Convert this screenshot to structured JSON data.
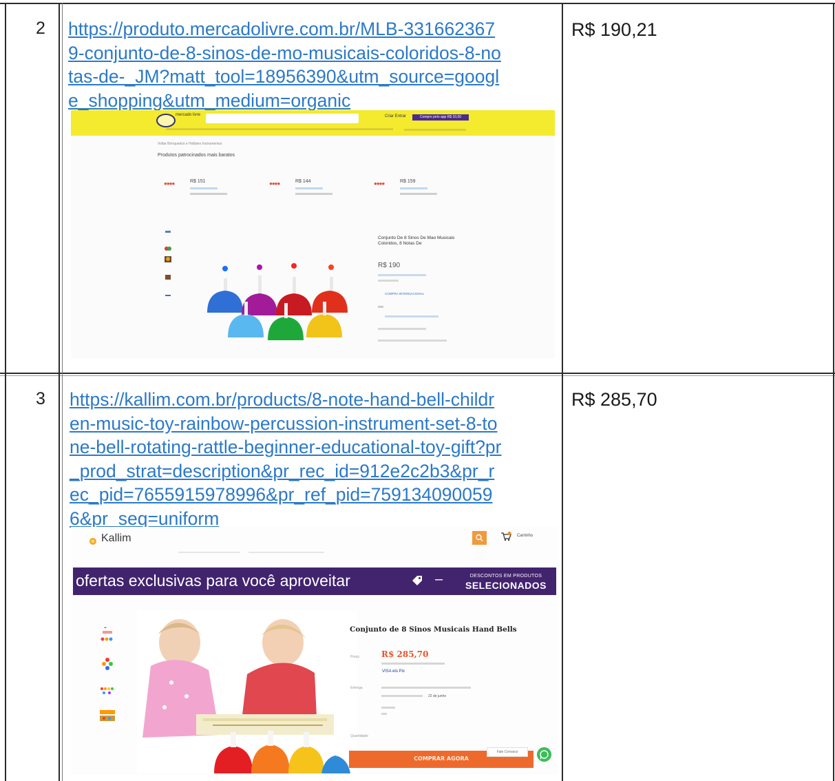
{
  "rows": [
    {
      "number": "2",
      "url": "https://produto.mercadolivre.com.br/MLB-3316623679-conjunto-de-8-sinos-de-mo-musicais-coloridos-8-notas-de-_JM?matt_tool=18956390&utm_source=google_shopping&utm_medium=organic",
      "url_lines": [
        "https://produto.mercadolivre.com.br/MLB-331662367",
        "9-conjunto-de-8-sinos-de-mo-musicais-coloridos-8-no",
        "tas-de-_JM?matt_tool=18956390&utm_source=googl",
        "e_shopping&utm_medium=organic"
      ],
      "price": "R$ 190,21",
      "screenshot": {
        "site": "Mercado Livre",
        "logo_text": "mercado livre",
        "user_text": "Criar  Entrar",
        "promo_text": "Compre pelo app R$ 10,00",
        "breadcrumb": "Voltar  Brinquedos e Hobbies  Instrumentos",
        "section_heading": "Produtos patrocinados mais baratos",
        "cards": [
          {
            "price": "R$ 151"
          },
          {
            "price": "R$ 144"
          },
          {
            "price": "R$ 159"
          }
        ],
        "product_title": "Conjunto De 8 Sinos De Mao Musicais Coloridos, 8 Notas De",
        "product_price": "R$ 190",
        "shipping_label": "COMPRA INTERNACIONAL"
      }
    },
    {
      "number": "3",
      "url": "https://kallim.com.br/products/8-note-hand-bell-children-music-toy-rainbow-percussion-instrument-set-8-tone-bell-rotating-rattle-beginner-educational-toy-gift?pr_prod_strat=description&pr_rec_id=912e2c2b3&pr_rec_pid=7655915978996&pr_ref_pid=7591340900596&pr_seq=uniform",
      "url_lines": [
        "https://kallim.com.br/products/8-note-hand-bell-childr",
        "en-music-toy-rainbow-percussion-instrument-set-8-to",
        "ne-bell-rotating-rattle-beginner-educational-toy-gift?pr",
        "_prod_strat=description&pr_rec_id=912e2c2b3&pr_r",
        "ec_pid=7655915978996&pr_ref_pid=759134090059",
        "6&pr_seq=uniform"
      ],
      "price": "R$ 285,70",
      "screenshot": {
        "site": "Kallim",
        "logo_text": "Kallim",
        "cart_label": "Carrinho",
        "banner_text": "ofertas exclusivas para você aproveitar",
        "banner_small": "DESCONTOS EM PRODUTOS",
        "banner_big": "SELECIONADOS",
        "product_title": "Conjunto de 8 Sinos Musicais Hand Bells",
        "price_label": "Preço",
        "product_price": "R$ 285,70",
        "payment_text": "VISA  elo  Pix",
        "delivery_label": "Entrega",
        "delivery_text": "22 de junho",
        "quantity_label": "Quantidade",
        "buy_button": "COMPRAR AGORA",
        "chat_label": "Fale Conosco"
      }
    }
  ]
}
